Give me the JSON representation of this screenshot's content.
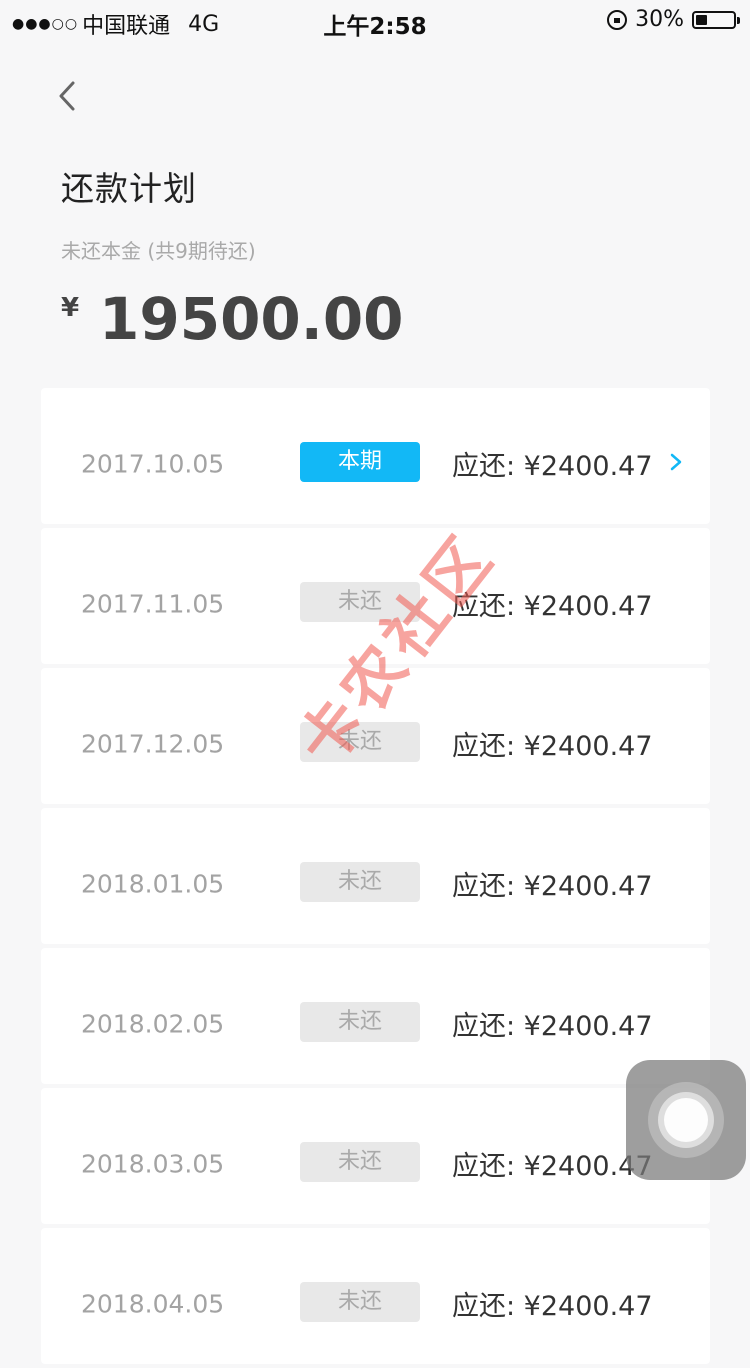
{
  "status_bar": {
    "signal": "●●●○○",
    "carrier": "中国联通",
    "network": "4G",
    "time": "上午2:58",
    "battery_percent": "30%",
    "battery_level": 0.3
  },
  "header": {
    "back_icon": "chevron-left-icon",
    "title": "还款计划",
    "subtitle": "未还本金 (共9期待还)",
    "currency_symbol": "¥",
    "amount": "19500.00"
  },
  "rows": [
    {
      "date": "2017.10.05",
      "status": "本期",
      "current": true,
      "due": "应还: ¥2400.47",
      "has_arrow": true
    },
    {
      "date": "2017.11.05",
      "status": "未还",
      "current": false,
      "due": "应还: ¥2400.47",
      "has_arrow": false
    },
    {
      "date": "2017.12.05",
      "status": "未还",
      "current": false,
      "due": "应还: ¥2400.47",
      "has_arrow": false
    },
    {
      "date": "2018.01.05",
      "status": "未还",
      "current": false,
      "due": "应还: ¥2400.47",
      "has_arrow": false
    },
    {
      "date": "2018.02.05",
      "status": "未还",
      "current": false,
      "due": "应还: ¥2400.47",
      "has_arrow": false
    },
    {
      "date": "2018.03.05",
      "status": "未还",
      "current": false,
      "due": "应还: ¥2400.47",
      "has_arrow": false
    },
    {
      "date": "2018.04.05",
      "status": "未还",
      "current": false,
      "due": "应还: ¥2400.47",
      "has_arrow": false
    }
  ],
  "watermark": {
    "text": "卡农社区"
  },
  "colors": {
    "accent": "#12b8f6",
    "badge_inactive_bg": "#e8e8e8",
    "watermark": "#f05a50"
  }
}
